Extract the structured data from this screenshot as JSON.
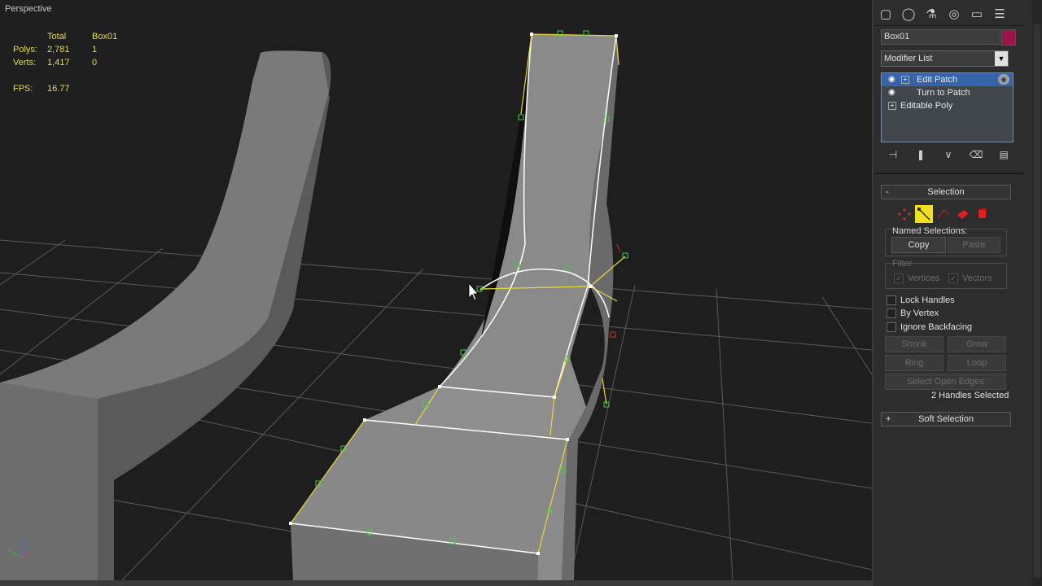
{
  "viewport": {
    "label": "Perspective",
    "stats": {
      "header_total": "Total",
      "header_object": "Box01",
      "polys_label": "Polys:",
      "polys_total": "2,781",
      "polys_object": "1",
      "verts_label": "Verts:",
      "verts_total": "1,417",
      "verts_object": "0",
      "fps_label": "FPS:",
      "fps_value": "16.77"
    }
  },
  "panel": {
    "toolbar_icons": [
      "create-icon",
      "modify-icon",
      "hierarchy-icon",
      "motion-icon",
      "display-icon",
      "utilities-icon"
    ],
    "object_name": "Box01",
    "object_color": "#9b1447",
    "modifier_list_label": "Modifier List",
    "stack": [
      {
        "label": "Edit Patch",
        "selected": true
      },
      {
        "label": "Turn to Patch",
        "selected": false
      },
      {
        "label": "Editable Poly",
        "selected": false
      }
    ],
    "selection": {
      "title": "Selection",
      "collapse": "-",
      "named_selections_label": "Named Selections:",
      "copy": "Copy",
      "paste": "Paste",
      "filter_label": "Filter",
      "vertices": "Vertices",
      "vectors": "Vectors",
      "lock_handles": "Lock Handles",
      "by_vertex": "By Vertex",
      "ignore_backfacing": "Ignore Backfacing",
      "shrink": "Shrink",
      "grow": "Grow",
      "ring": "Ring",
      "loop": "Loop",
      "select_open_edges": "Select Open Edges",
      "status": "2 Handles Selected"
    },
    "soft_selection": {
      "title": "Soft Selection",
      "expand": "+"
    }
  }
}
